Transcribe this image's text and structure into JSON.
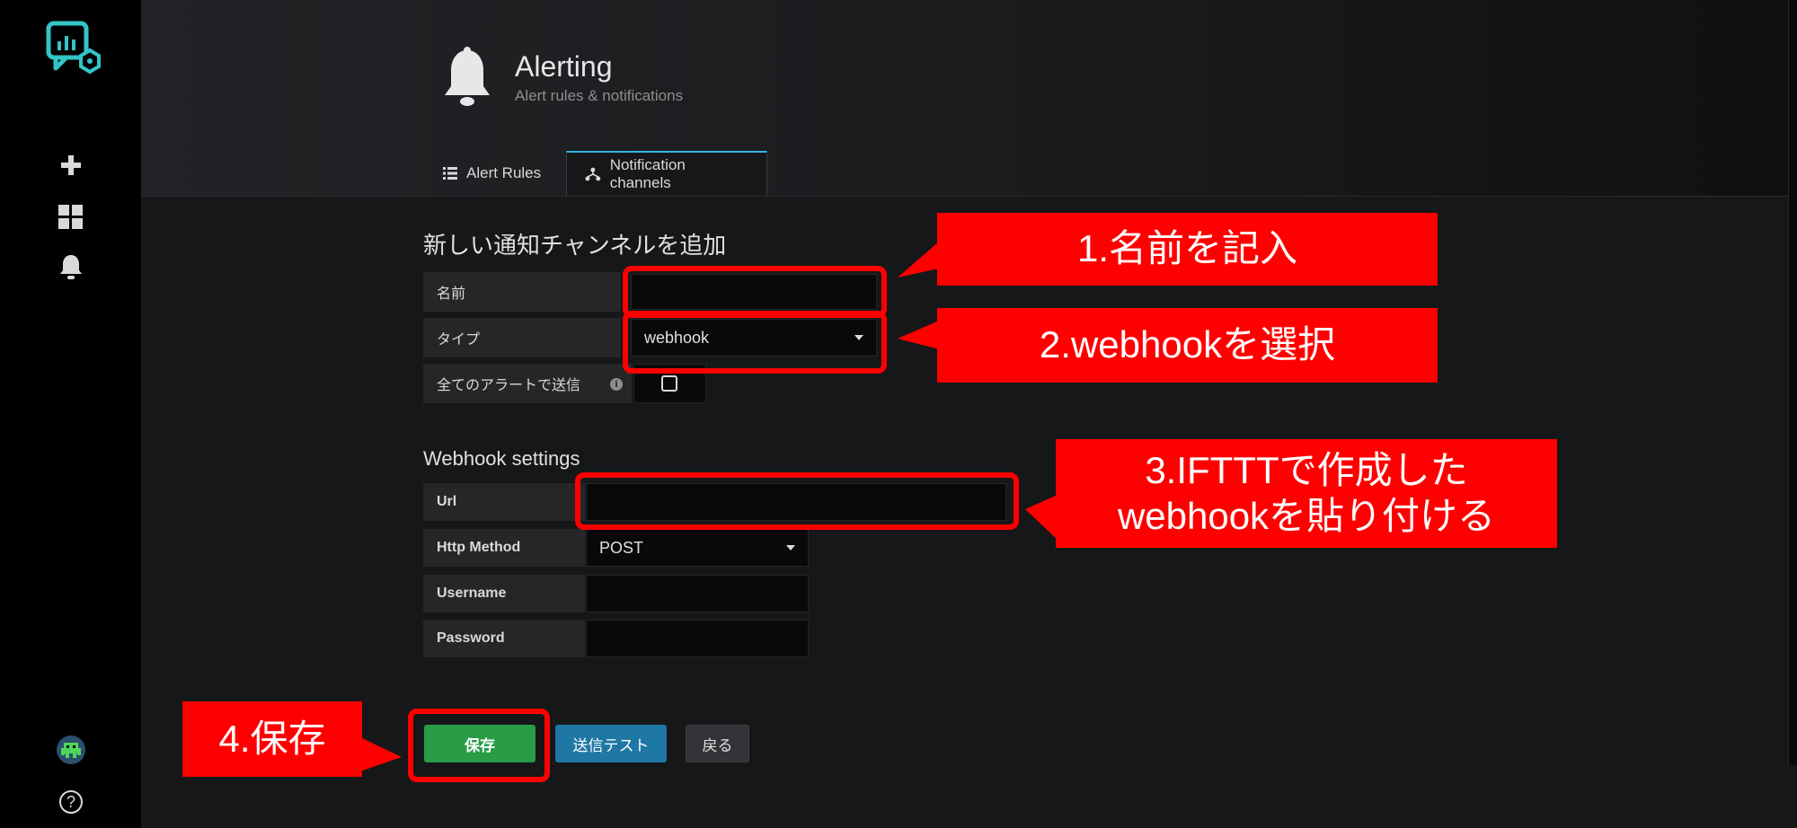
{
  "header": {
    "title": "Alerting",
    "subtitle": "Alert rules & notifications"
  },
  "tabs": [
    {
      "label": "Alert Rules"
    },
    {
      "label": "Notification channels",
      "active": true
    }
  ],
  "form": {
    "section_title": "新しい通知チャンネルを追加",
    "name_label": "名前",
    "name_value": "",
    "type_label": "タイプ",
    "type_value": "webhook",
    "send_all_label": "全てのアラートで送信",
    "send_all_checked": false
  },
  "webhook": {
    "section_title": "Webhook settings",
    "url_label": "Url",
    "url_value": "",
    "method_label": "Http Method",
    "method_value": "POST",
    "username_label": "Username",
    "username_value": "",
    "password_label": "Password",
    "password_value": ""
  },
  "buttons": {
    "save": "保存",
    "test": "送信テスト",
    "back": "戻る"
  },
  "annotations": {
    "step1": "1.名前を記入",
    "step2": "2.webhookを選択",
    "step3_line1": "3.IFTTTで作成した",
    "step3_line2": "webhookを貼り付ける",
    "step4": "4.保存"
  },
  "sidebar": {
    "help_glyph": "?"
  },
  "colors": {
    "accent": "#33b5e5",
    "annotation_red": "#ff0000",
    "save_green": "#299c46",
    "test_blue": "#1f77a4"
  }
}
